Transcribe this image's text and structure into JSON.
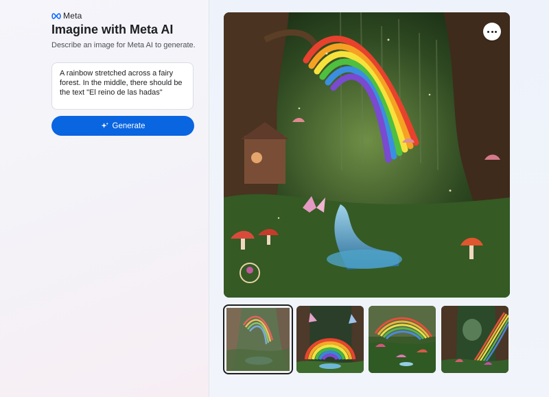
{
  "brand": {
    "name": "Meta"
  },
  "header": {
    "title": "Imagine with Meta AI",
    "subtitle": "Describe an image for Meta AI to generate."
  },
  "prompt": {
    "value": "A rainbow stretched across a fairy forest. In the middle, there should be the text \"El reino de las hadas\""
  },
  "generate_button": {
    "label": "Generate",
    "icon": "sparkle-icon"
  },
  "main_image": {
    "more_options_icon": "more-horizontal-icon"
  },
  "thumbnails": [
    {
      "selected": true
    },
    {
      "selected": false
    },
    {
      "selected": false
    },
    {
      "selected": false
    }
  ],
  "colors": {
    "accent": "#0a65e0",
    "text": "#1c1e21",
    "muted": "#4b4f56"
  }
}
